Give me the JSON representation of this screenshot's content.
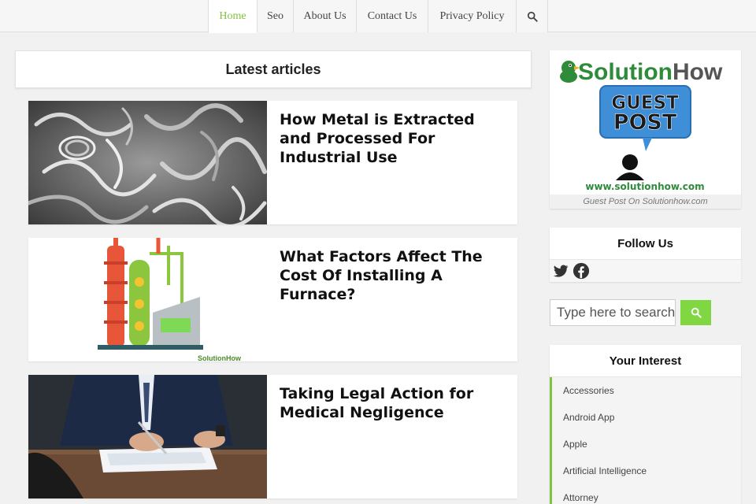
{
  "nav": {
    "items": [
      "Home",
      "Seo",
      "About Us",
      "Contact Us",
      "Privacy Policy"
    ],
    "active_index": 0,
    "search_icon": "search-icon",
    "accent_color": "#81c341"
  },
  "main": {
    "heading": "Latest articles",
    "articles": [
      {
        "title": "How Metal is Extracted and Processed For Industrial Use",
        "image": "metal-shavings"
      },
      {
        "title": "What Factors Affect The Cost Of Installing A Furnace?",
        "image": "industrial-furnace-illustration"
      },
      {
        "title": "Taking Legal Action for Medical Negligence",
        "image": "signing-document"
      }
    ]
  },
  "sidebar": {
    "guest_post": {
      "brand": "SolutionHow",
      "brand_part1": "Solution",
      "brand_part2": "How",
      "badge_line1": "GUEST",
      "badge_line2": "POST",
      "url": "www.solutionhow.com",
      "caption": "Guest Post On Solutionhow.com"
    },
    "follow": {
      "heading": "Follow Us",
      "icons": [
        "twitter-icon",
        "facebook-icon"
      ]
    },
    "search": {
      "placeholder": "Type here to search...",
      "button_icon": "search-icon",
      "button_color": "#81d742"
    },
    "interest": {
      "heading": "Your Interest",
      "items": [
        "Accessories",
        "Android App",
        "Apple",
        "Artificial Intelligence",
        "Attorney"
      ]
    }
  }
}
